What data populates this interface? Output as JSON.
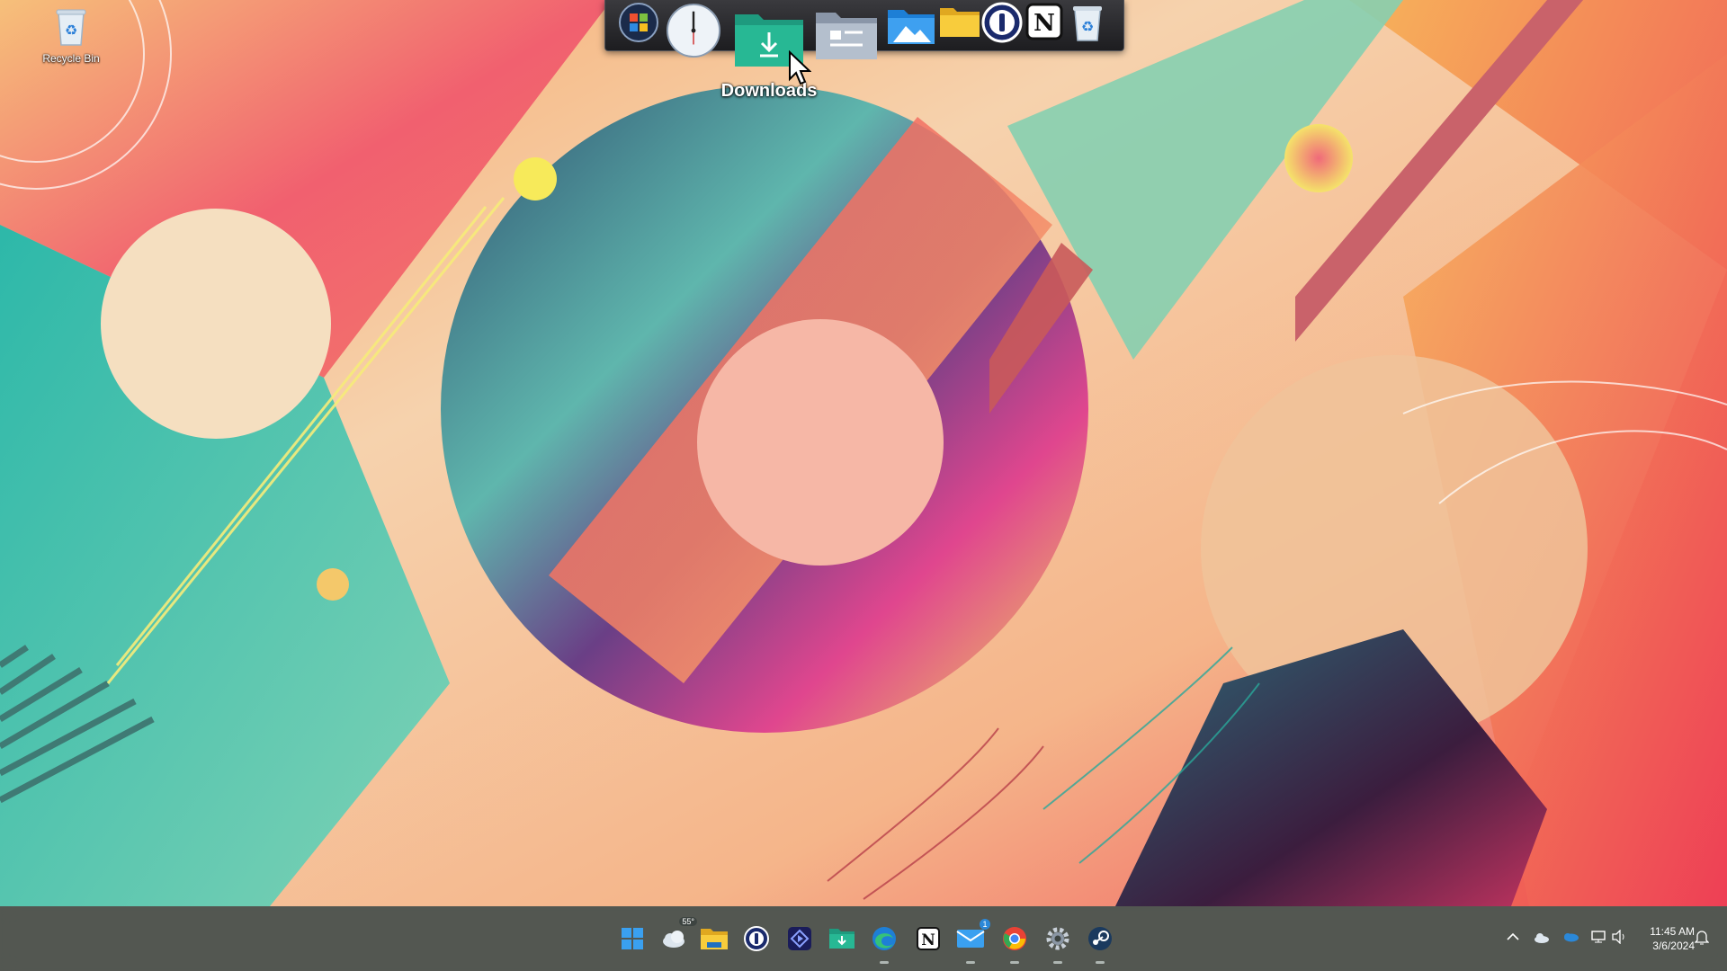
{
  "desktop": {
    "icons": [
      {
        "label": "Recycle Bin",
        "icon": "recycle-bin-icon"
      }
    ]
  },
  "dock": {
    "items": [
      {
        "name": "start-orb",
        "icon": "windows-orb-icon"
      },
      {
        "name": "clock",
        "icon": "clock-icon"
      },
      {
        "name": "downloads",
        "icon": "downloads-folder-icon"
      },
      {
        "name": "documents",
        "icon": "documents-folder-icon"
      },
      {
        "name": "pictures",
        "icon": "pictures-folder-icon"
      },
      {
        "name": "folder",
        "icon": "folder-icon"
      },
      {
        "name": "1password",
        "icon": "1password-icon"
      },
      {
        "name": "notion",
        "icon": "notion-icon"
      },
      {
        "name": "recycle-bin",
        "icon": "recycle-bin-icon"
      }
    ],
    "tooltip": "Downloads"
  },
  "taskbar": {
    "apps": [
      {
        "name": "start",
        "icon": "windows-start-icon",
        "running": false
      },
      {
        "name": "weather",
        "icon": "weather-icon",
        "temp": "55°",
        "running": false
      },
      {
        "name": "file-explorer",
        "icon": "file-explorer-icon",
        "running": false
      },
      {
        "name": "1password",
        "icon": "1password-icon",
        "running": false
      },
      {
        "name": "media-app",
        "icon": "media-app-icon",
        "running": false
      },
      {
        "name": "downloads",
        "icon": "downloads-folder-icon",
        "running": false
      },
      {
        "name": "edge",
        "icon": "edge-icon",
        "running": true
      },
      {
        "name": "notion",
        "icon": "notion-icon",
        "running": false
      },
      {
        "name": "mail",
        "icon": "mail-icon",
        "badge": "1",
        "running": true
      },
      {
        "name": "chrome",
        "icon": "chrome-icon",
        "running": true
      },
      {
        "name": "settings",
        "icon": "settings-gear-icon",
        "running": true
      },
      {
        "name": "steam",
        "icon": "steam-icon",
        "running": true
      }
    ],
    "tray": [
      {
        "name": "show-hidden-icons",
        "icon": "chevron-up-icon"
      },
      {
        "name": "weather-tray",
        "icon": "cloud-sun-icon"
      },
      {
        "name": "onedrive",
        "icon": "onedrive-icon"
      },
      {
        "name": "display",
        "icon": "monitor-icon"
      },
      {
        "name": "volume",
        "icon": "speaker-icon"
      }
    ],
    "clock": {
      "time": "11:45 AM",
      "date": "3/6/2024"
    },
    "notifications": {
      "icon": "bell-icon"
    }
  }
}
